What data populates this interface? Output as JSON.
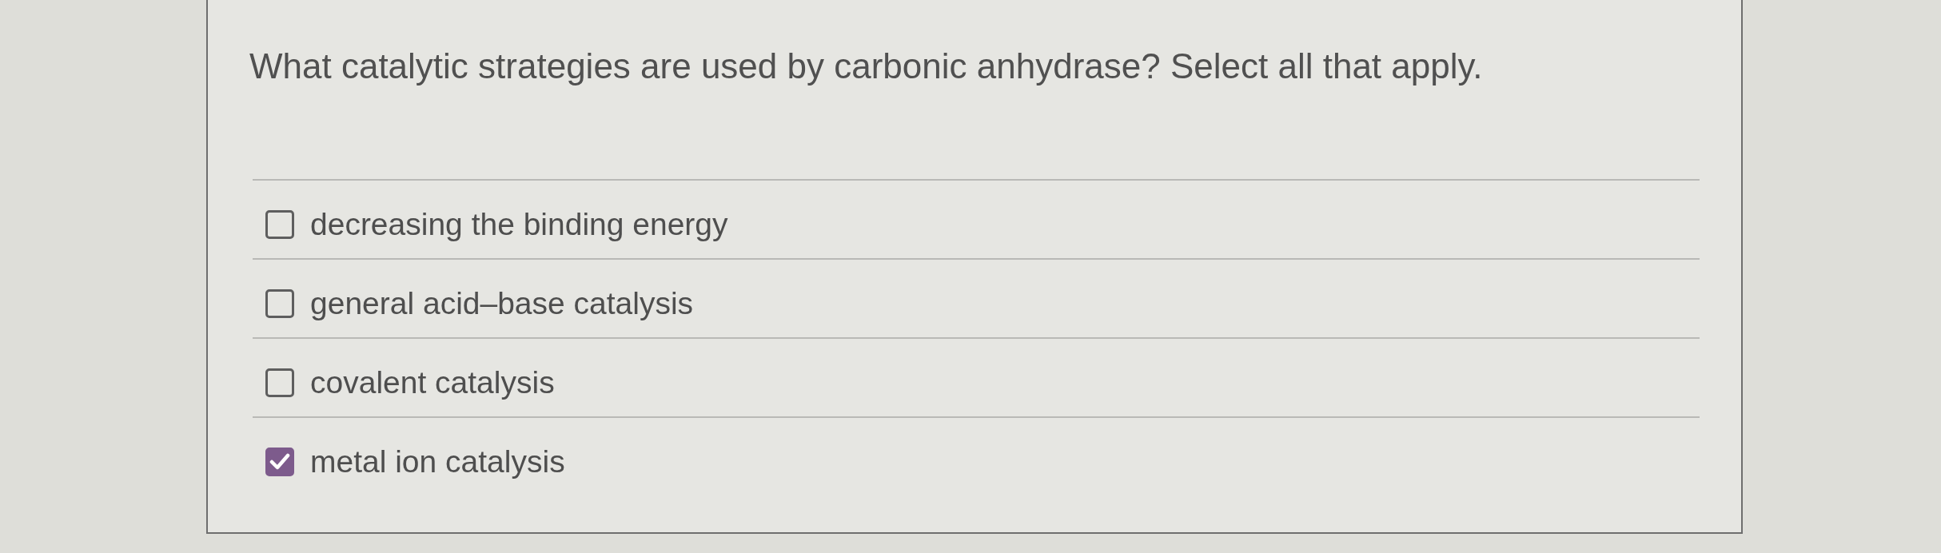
{
  "question": {
    "text": "What catalytic strategies are used by carbonic anhydrase? Select all that apply."
  },
  "options": [
    {
      "label": "decreasing the binding energy",
      "checked": false
    },
    {
      "label": "general acid–base catalysis",
      "checked": false
    },
    {
      "label": "covalent catalysis",
      "checked": false
    },
    {
      "label": "metal ion catalysis",
      "checked": true
    }
  ]
}
